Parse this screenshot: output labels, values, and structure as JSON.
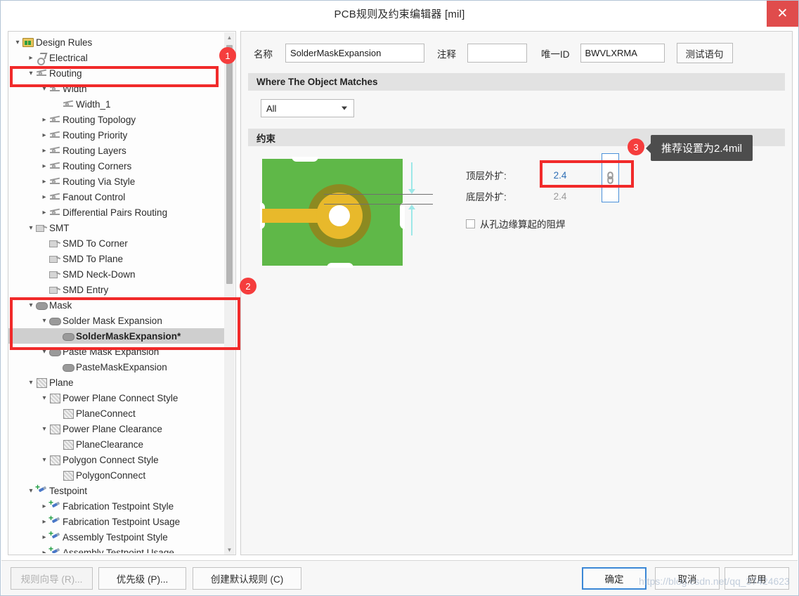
{
  "window": {
    "title": "PCB规则及约束编辑器 [mil]",
    "close_label": "✕"
  },
  "tree": {
    "items": [
      {
        "label": "Design Rules",
        "depth": 0,
        "icon": "folder-icon",
        "arrow": "expanded",
        "selected": false
      },
      {
        "label": "Electrical",
        "depth": 1,
        "icon": "electrical-icon",
        "arrow": "collapsed",
        "selected": false
      },
      {
        "label": "Routing",
        "depth": 1,
        "icon": "routing-icon",
        "arrow": "expanded",
        "selected": false
      },
      {
        "label": "Width",
        "depth": 2,
        "icon": "routing-icon",
        "arrow": "expanded",
        "selected": false
      },
      {
        "label": "Width_1",
        "depth": 3,
        "icon": "routing-icon",
        "arrow": "none",
        "selected": false
      },
      {
        "label": "Routing Topology",
        "depth": 2,
        "icon": "routing-icon",
        "arrow": "collapsed",
        "selected": false
      },
      {
        "label": "Routing Priority",
        "depth": 2,
        "icon": "routing-icon",
        "arrow": "collapsed",
        "selected": false
      },
      {
        "label": "Routing Layers",
        "depth": 2,
        "icon": "routing-icon",
        "arrow": "collapsed",
        "selected": false
      },
      {
        "label": "Routing Corners",
        "depth": 2,
        "icon": "routing-icon",
        "arrow": "collapsed",
        "selected": false
      },
      {
        "label": "Routing Via Style",
        "depth": 2,
        "icon": "routing-icon",
        "arrow": "collapsed",
        "selected": false
      },
      {
        "label": "Fanout Control",
        "depth": 2,
        "icon": "routing-icon",
        "arrow": "collapsed",
        "selected": false
      },
      {
        "label": "Differential Pairs Routing",
        "depth": 2,
        "icon": "routing-icon",
        "arrow": "collapsed",
        "selected": false
      },
      {
        "label": "SMT",
        "depth": 1,
        "icon": "smt-icon",
        "arrow": "expanded",
        "selected": false
      },
      {
        "label": "SMD To Corner",
        "depth": 2,
        "icon": "smt-icon",
        "arrow": "none",
        "selected": false
      },
      {
        "label": "SMD To Plane",
        "depth": 2,
        "icon": "smt-icon",
        "arrow": "none",
        "selected": false
      },
      {
        "label": "SMD Neck-Down",
        "depth": 2,
        "icon": "smt-icon",
        "arrow": "none",
        "selected": false
      },
      {
        "label": "SMD Entry",
        "depth": 2,
        "icon": "smt-icon",
        "arrow": "none",
        "selected": false
      },
      {
        "label": "Mask",
        "depth": 1,
        "icon": "mask-icon",
        "arrow": "expanded",
        "selected": false
      },
      {
        "label": "Solder Mask Expansion",
        "depth": 2,
        "icon": "mask-icon",
        "arrow": "expanded",
        "selected": false
      },
      {
        "label": "SolderMaskExpansion*",
        "depth": 3,
        "icon": "mask-icon",
        "arrow": "none",
        "selected": true
      },
      {
        "label": "Paste Mask Expansion",
        "depth": 2,
        "icon": "mask-icon",
        "arrow": "expanded",
        "selected": false
      },
      {
        "label": "PasteMaskExpansion",
        "depth": 3,
        "icon": "mask-icon",
        "arrow": "none",
        "selected": false
      },
      {
        "label": "Plane",
        "depth": 1,
        "icon": "plane-icon",
        "arrow": "expanded",
        "selected": false
      },
      {
        "label": "Power Plane Connect Style",
        "depth": 2,
        "icon": "plane-icon",
        "arrow": "expanded",
        "selected": false
      },
      {
        "label": "PlaneConnect",
        "depth": 3,
        "icon": "plane-icon",
        "arrow": "none",
        "selected": false
      },
      {
        "label": "Power Plane Clearance",
        "depth": 2,
        "icon": "plane-icon",
        "arrow": "expanded",
        "selected": false
      },
      {
        "label": "PlaneClearance",
        "depth": 3,
        "icon": "plane-icon",
        "arrow": "none",
        "selected": false
      },
      {
        "label": "Polygon Connect Style",
        "depth": 2,
        "icon": "plane-icon",
        "arrow": "expanded",
        "selected": false
      },
      {
        "label": "PolygonConnect",
        "depth": 3,
        "icon": "plane-icon",
        "arrow": "none",
        "selected": false
      },
      {
        "label": "Testpoint",
        "depth": 1,
        "icon": "testpoint-icon",
        "arrow": "expanded",
        "selected": false
      },
      {
        "label": "Fabrication Testpoint Style",
        "depth": 2,
        "icon": "testpoint-icon",
        "arrow": "collapsed",
        "selected": false
      },
      {
        "label": "Fabrication Testpoint Usage",
        "depth": 2,
        "icon": "testpoint-icon",
        "arrow": "collapsed",
        "selected": false
      },
      {
        "label": "Assembly Testpoint Style",
        "depth": 2,
        "icon": "testpoint-icon",
        "arrow": "collapsed",
        "selected": false
      },
      {
        "label": "Assembly Testpoint Usage",
        "depth": 2,
        "icon": "testpoint-icon",
        "arrow": "collapsed",
        "selected": false
      }
    ]
  },
  "form": {
    "name_label": "名称",
    "name_value": "SolderMaskExpansion",
    "comment_label": "注释",
    "comment_value": "",
    "comment_placeholder": "",
    "uid_label": "唯一ID",
    "uid_value": "BWVLXRMA",
    "test_button": "测试语句"
  },
  "scope": {
    "header": "Where The Object Matches",
    "selected": "All"
  },
  "constraint": {
    "header": "约束",
    "top_label": "顶层外扩:",
    "top_value": "2.4",
    "bottom_label": "底层外扩:",
    "bottom_value": "2.4",
    "checkbox_label": "从孔边缘算起的阻焊",
    "checkbox_checked": false,
    "link_icon": "chain-link-icon"
  },
  "annotations": {
    "badge_1": "1",
    "badge_2": "2",
    "badge_3": "3",
    "tooltip": "推荐设置为2.4mil",
    "box_color": "#f12a2a"
  },
  "footer": {
    "wizard": "规则向导 (R)...",
    "priority": "优先级 (P)...",
    "default_rules": "创建默认规则 (C)",
    "ok": "确定",
    "cancel": "取消",
    "apply": "应用"
  },
  "watermark": "https://blog.csdn.net/qq_37424623"
}
